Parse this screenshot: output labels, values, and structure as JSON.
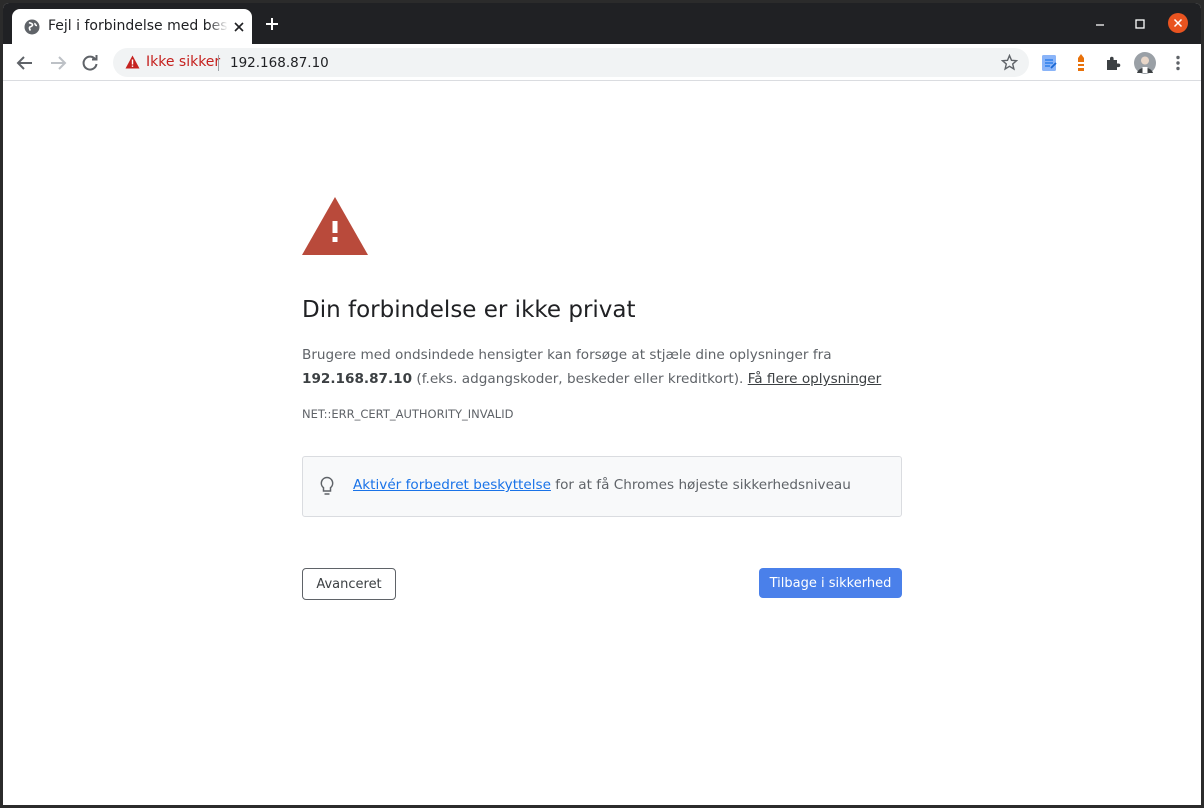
{
  "tab": {
    "title": "Fejl i forbindelse med beskyttelse af personlige oplysninger"
  },
  "toolbar": {
    "security_label": "Ikke sikker",
    "url": "192.168.87.10"
  },
  "page": {
    "heading": "Din forbindelse er ikke privat",
    "desc_part1": "Brugere med ondsindede hensigter kan forsøge at stjæle dine oplysninger fra ",
    "desc_host": "192.168.87.10",
    "desc_part2": " (f.eks. adgangskoder, beskeder eller kreditkort). ",
    "desc_link": "Få flere oplysninger",
    "error_code": "NET::ERR_CERT_AUTHORITY_INVALID",
    "enhanced_link": "Aktivér forbedret beskyttelse",
    "enhanced_text": " for at få Chromes højeste sikkerhedsniveau",
    "advanced_button": "Avanceret",
    "back_button": "Tilbage i sikkerhed"
  },
  "colors": {
    "warning_red": "#c5221f",
    "warning_triangle": "#b94a3b",
    "primary_button": "#4a80ea",
    "link_blue": "#1a73e8"
  },
  "icons": {
    "tab_favicon": "globe-icon",
    "tab_close": "close-icon",
    "new_tab": "plus-icon",
    "minimize": "minimize-icon",
    "maximize": "maximize-icon",
    "close_window": "close-window-icon",
    "back": "arrow-left-icon",
    "forward": "arrow-right-icon",
    "reload": "reload-icon",
    "not_secure": "warning-icon",
    "bookmark": "star-icon",
    "extensions": [
      "notes-extension-icon",
      "lighthouse-extension-icon",
      "puzzle-icon",
      "avatar"
    ],
    "menu": "kebab-menu-icon",
    "bulb": "lightbulb-icon"
  }
}
